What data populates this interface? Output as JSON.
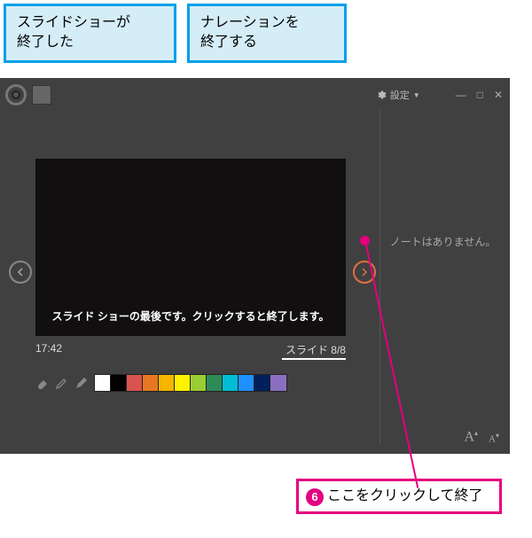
{
  "callouts": {
    "c1": "スライドショーが\n終了した",
    "c2": "ナレーションを\n終了する"
  },
  "titlebar": {
    "settings_label": "設定"
  },
  "slide": {
    "end_message": "スライド ショーの最後です。クリックすると終了します。",
    "time": "17:42",
    "counter": "スライド 8/8"
  },
  "notes": {
    "empty": "ノートはありません。"
  },
  "swatches": [
    "#ffffff",
    "#000000",
    "#d9534f",
    "#e87722",
    "#f7b500",
    "#fff200",
    "#9acd32",
    "#2e8b57",
    "#00bcd4",
    "#1e90ff",
    "#001f5b",
    "#8a6fc1"
  ],
  "instruction": {
    "step": "6",
    "text": "ここをクリックして終了"
  }
}
